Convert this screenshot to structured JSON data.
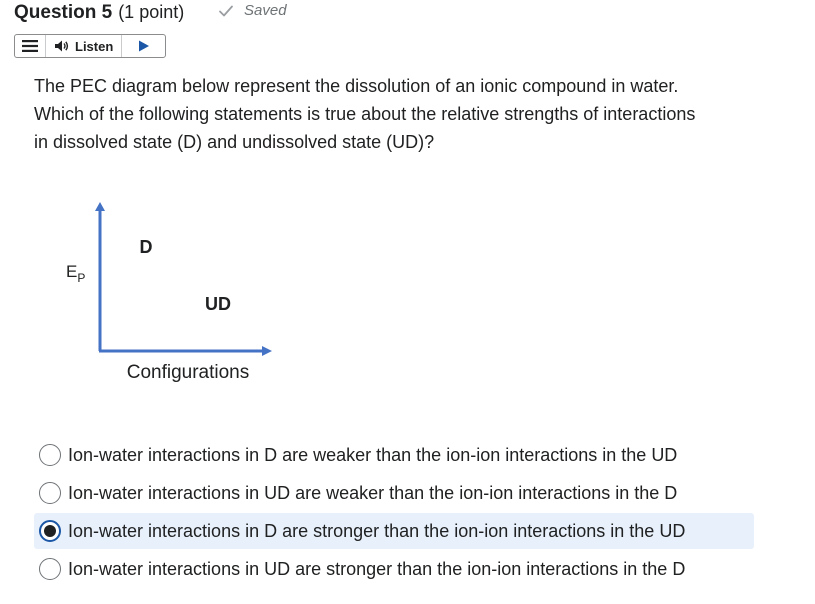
{
  "header": {
    "title": "Question 5",
    "points": "(1 point)",
    "saved_label": "Saved"
  },
  "listen": {
    "label": "Listen"
  },
  "question": {
    "line1": "The PEC diagram below represent the dissolution of an ionic compound in water.",
    "line2": "Which of the following statements is true about the relative strengths of interactions",
    "line3": "in dissolved state (D) and undissolved state (UD)?"
  },
  "diagram": {
    "y_axis_label": "E",
    "y_axis_subscript": "P",
    "x_axis_label": "Configurations",
    "state_d_label": "D",
    "state_ud_label": "UD"
  },
  "options": [
    {
      "text": "Ion-water interactions in D are weaker than the ion-ion interactions in the UD",
      "selected": false
    },
    {
      "text": "Ion-water interactions in UD are weaker than the ion-ion interactions in the D",
      "selected": false
    },
    {
      "text": "Ion-water interactions in D are stronger than the ion-ion interactions in the UD",
      "selected": true
    },
    {
      "text": "Ion-water interactions in UD are stronger than the ion-ion interactions in the D",
      "selected": false
    }
  ],
  "colors": {
    "axis": "#4472c4",
    "selected_bg": "#e8f1fb",
    "radio_checked_border": "#1b57a6"
  }
}
